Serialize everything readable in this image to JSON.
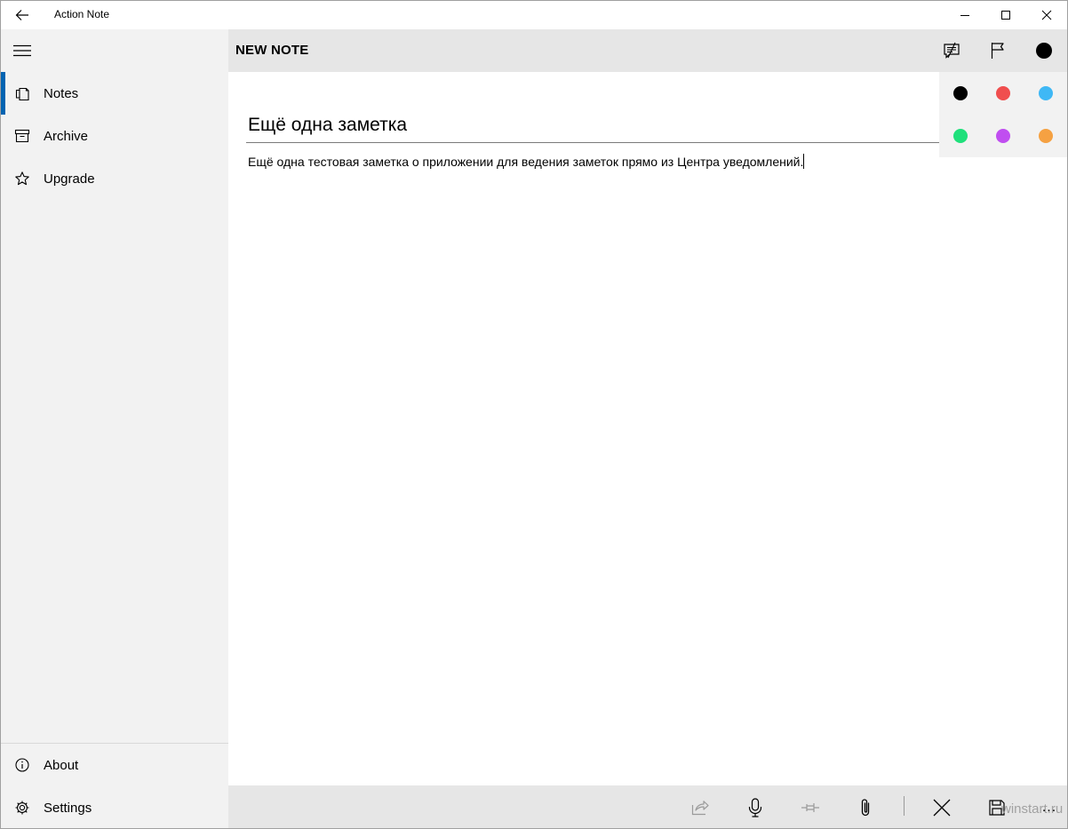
{
  "window": {
    "title": "Action Note",
    "back_icon": "arrow-left-icon",
    "controls": [
      "minimize-icon",
      "maximize-icon",
      "close-icon"
    ]
  },
  "sidebar": {
    "menu_icon": "hamburger-icon",
    "items": [
      {
        "label": "Notes",
        "icon": "notes-icon",
        "active": true
      },
      {
        "label": "Archive",
        "icon": "archive-icon",
        "active": false
      },
      {
        "label": "Upgrade",
        "icon": "star-icon",
        "active": false
      }
    ],
    "footer_items": [
      {
        "label": "About",
        "icon": "info-icon"
      },
      {
        "label": "Settings",
        "icon": "gear-icon"
      }
    ],
    "accent_color": "#0063b1"
  },
  "header": {
    "title": "NEW NOTE",
    "actions": [
      "reminder-note-icon",
      "flag-icon",
      "color-dot-icon"
    ],
    "selected_color": "#000000"
  },
  "note": {
    "title": "Ещё одна заметка",
    "body": "Ещё одна тестовая заметка о приложении для ведения заметок прямо из Центра уведомлений."
  },
  "palette": {
    "colors": [
      "#000000",
      "#f04e4e",
      "#3fb8f5",
      "#1fe07b",
      "#c04ef0",
      "#f5a142"
    ]
  },
  "bottom_bar": {
    "actions": [
      "share-icon",
      "microphone-icon",
      "pin-icon",
      "attach-icon",
      "discard-icon",
      "save-icon"
    ],
    "more_label": "...",
    "watermark": "winstart.ru"
  }
}
